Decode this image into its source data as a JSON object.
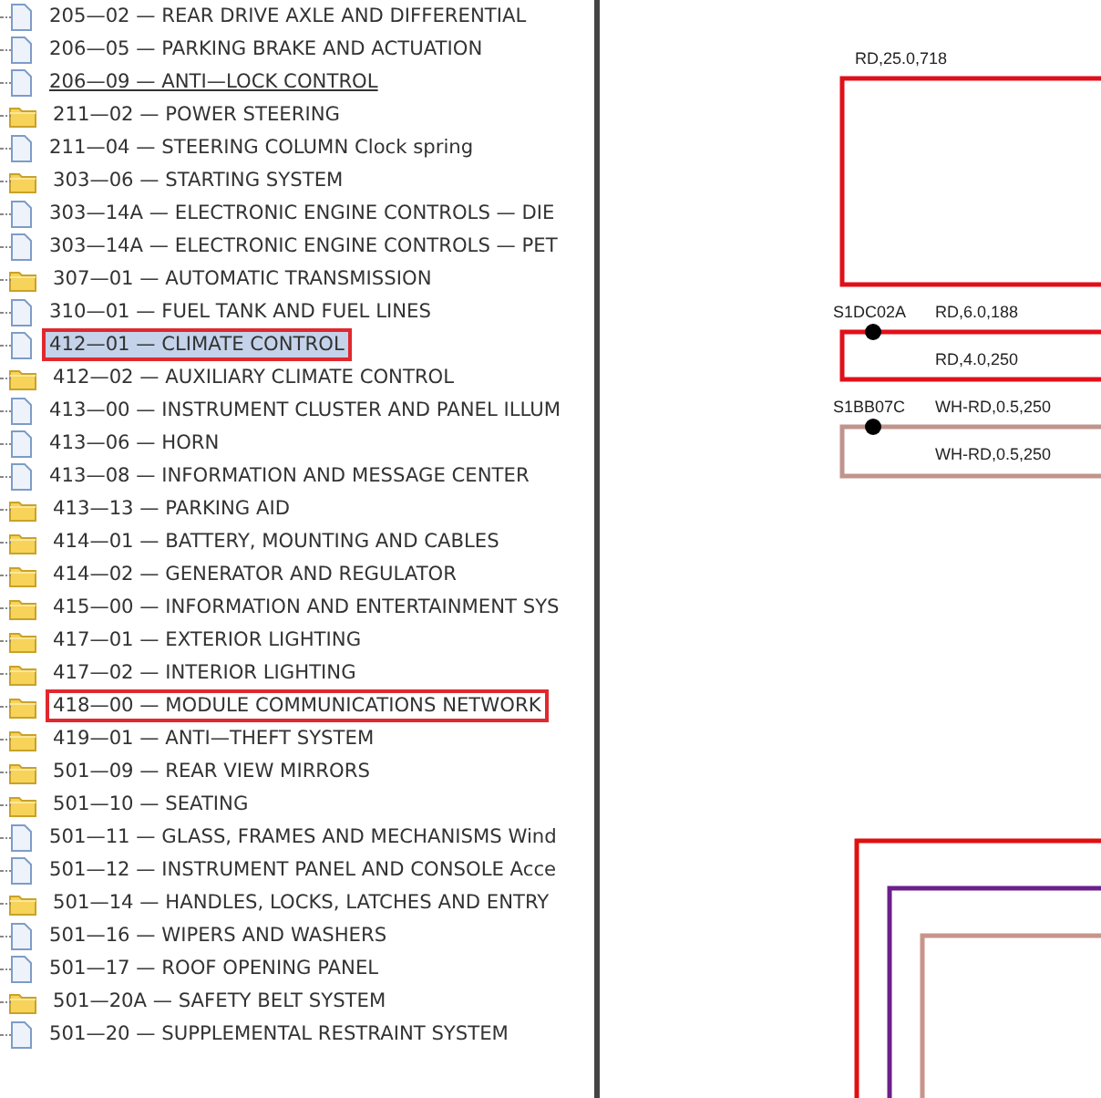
{
  "tree": {
    "items": [
      {
        "label": "205—02 — REAR DRIVE AXLE AND DIFFERENTIAL",
        "kind": "document",
        "selected": false,
        "hover": false,
        "highlighted": false
      },
      {
        "label": "206—05 — PARKING BRAKE AND ACTUATION",
        "kind": "document",
        "selected": false,
        "hover": false,
        "highlighted": false
      },
      {
        "label": "206—09 — ANTI—LOCK CONTROL",
        "kind": "document",
        "selected": false,
        "hover": true,
        "highlighted": false
      },
      {
        "label": "211—02 — POWER STEERING",
        "kind": "folder",
        "selected": false,
        "hover": false,
        "highlighted": false
      },
      {
        "label": "211—04 — STEERING COLUMN Clock spring",
        "kind": "document",
        "selected": false,
        "hover": false,
        "highlighted": false
      },
      {
        "label": "303—06 — STARTING SYSTEM",
        "kind": "folder",
        "selected": false,
        "hover": false,
        "highlighted": false
      },
      {
        "label": "303—14A — ELECTRONIC ENGINE CONTROLS — DIE",
        "kind": "document",
        "selected": false,
        "hover": false,
        "highlighted": false
      },
      {
        "label": "303—14A — ELECTRONIC ENGINE CONTROLS — PET",
        "kind": "document",
        "selected": false,
        "hover": false,
        "highlighted": false
      },
      {
        "label": "307—01 — AUTOMATIC TRANSMISSION",
        "kind": "folder",
        "selected": false,
        "hover": false,
        "highlighted": false
      },
      {
        "label": "310—01 — FUEL TANK AND FUEL LINES",
        "kind": "document",
        "selected": false,
        "hover": false,
        "highlighted": false
      },
      {
        "label": "412—01 — CLIMATE CONTROL",
        "kind": "document",
        "selected": true,
        "hover": false,
        "highlighted": true
      },
      {
        "label": "412—02 — AUXILIARY CLIMATE CONTROL",
        "kind": "folder",
        "selected": false,
        "hover": false,
        "highlighted": false
      },
      {
        "label": "413—00 — INSTRUMENT CLUSTER AND PANEL ILLUM",
        "kind": "document",
        "selected": false,
        "hover": false,
        "highlighted": false
      },
      {
        "label": "413—06 — HORN",
        "kind": "document",
        "selected": false,
        "hover": false,
        "highlighted": false
      },
      {
        "label": "413—08 — INFORMATION AND MESSAGE CENTER",
        "kind": "document",
        "selected": false,
        "hover": false,
        "highlighted": false
      },
      {
        "label": "413—13 — PARKING AID",
        "kind": "folder",
        "selected": false,
        "hover": false,
        "highlighted": false
      },
      {
        "label": "414—01 — BATTERY, MOUNTING AND CABLES",
        "kind": "folder",
        "selected": false,
        "hover": false,
        "highlighted": false
      },
      {
        "label": "414—02 — GENERATOR AND REGULATOR",
        "kind": "folder",
        "selected": false,
        "hover": false,
        "highlighted": false
      },
      {
        "label": "415—00 — INFORMATION AND ENTERTAINMENT SYS",
        "kind": "folder",
        "selected": false,
        "hover": false,
        "highlighted": false
      },
      {
        "label": "417—01 — EXTERIOR LIGHTING",
        "kind": "folder",
        "selected": false,
        "hover": false,
        "highlighted": false
      },
      {
        "label": "417—02 — INTERIOR LIGHTING",
        "kind": "folder",
        "selected": false,
        "hover": false,
        "highlighted": false
      },
      {
        "label": "418—00 — MODULE COMMUNICATIONS NETWORK",
        "kind": "folder",
        "selected": false,
        "hover": false,
        "highlighted": true
      },
      {
        "label": "419—01 — ANTI—THEFT SYSTEM",
        "kind": "folder",
        "selected": false,
        "hover": false,
        "highlighted": false
      },
      {
        "label": "501—09 — REAR VIEW MIRRORS",
        "kind": "folder",
        "selected": false,
        "hover": false,
        "highlighted": false
      },
      {
        "label": "501—10 — SEATING",
        "kind": "folder",
        "selected": false,
        "hover": false,
        "highlighted": false
      },
      {
        "label": "501—11 — GLASS, FRAMES AND MECHANISMS Wind",
        "kind": "document",
        "selected": false,
        "hover": false,
        "highlighted": false
      },
      {
        "label": "501—12 — INSTRUMENT PANEL AND CONSOLE Acce",
        "kind": "document",
        "selected": false,
        "hover": false,
        "highlighted": false
      },
      {
        "label": "501—14 — HANDLES, LOCKS, LATCHES AND ENTRY",
        "kind": "folder",
        "selected": false,
        "hover": false,
        "highlighted": false
      },
      {
        "label": "501—16 — WIPERS AND WASHERS",
        "kind": "document",
        "selected": false,
        "hover": false,
        "highlighted": false
      },
      {
        "label": "501—17 — ROOF OPENING PANEL",
        "kind": "document",
        "selected": false,
        "hover": false,
        "highlighted": false
      },
      {
        "label": "501—20A — SAFETY BELT SYSTEM",
        "kind": "folder",
        "selected": false,
        "hover": false,
        "highlighted": false
      },
      {
        "label": "501—20 — SUPPLEMENTAL RESTRAINT SYSTEM",
        "kind": "document",
        "selected": false,
        "hover": false,
        "highlighted": false
      }
    ]
  },
  "diagram": {
    "wires": [
      {
        "label": "RD,25.0,718",
        "color": "#e0101a"
      },
      {
        "connector": "S1DC02A",
        "label": "RD,6.0,188",
        "inner_label": "RD,4.0,250",
        "color": "#e0101a"
      },
      {
        "connector": "S1BB07C",
        "label": "WH-RD,0.5,250",
        "inner_label": "WH-RD,0.5,250",
        "color": "#c0948c"
      }
    ],
    "loops": [
      {
        "color": "#e01010"
      },
      {
        "color": "#6a1f8a"
      },
      {
        "color": "#c8948a"
      }
    ]
  }
}
